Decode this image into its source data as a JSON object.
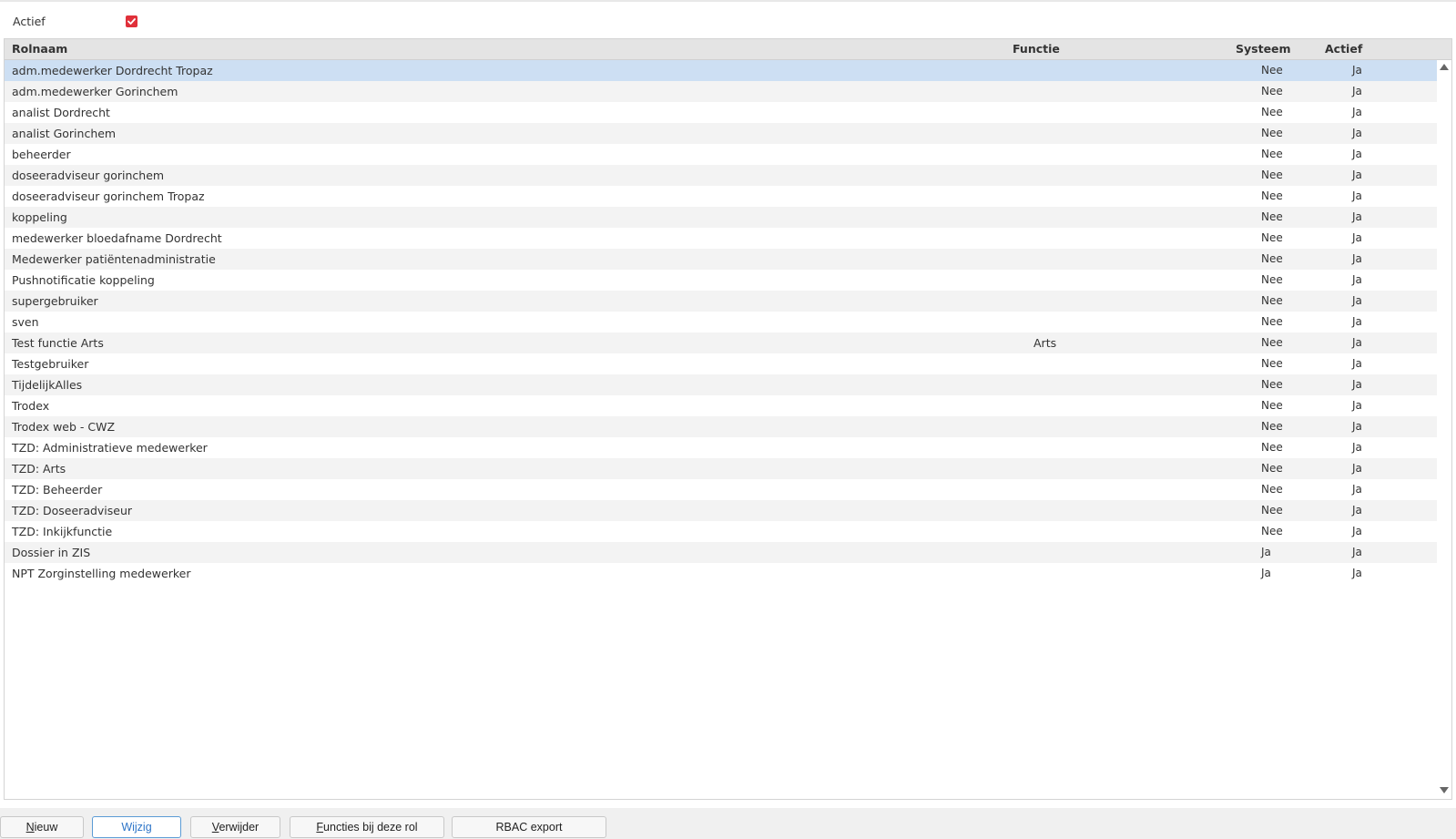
{
  "filter": {
    "label": "Actief",
    "checked": true,
    "check_color": "#e0303a"
  },
  "table": {
    "columns": {
      "name": "Rolnaam",
      "functie": "Functie",
      "systeem": "Systeem",
      "actief": "Actief"
    },
    "selected_index": 0,
    "rows": [
      {
        "name": "adm.medewerker Dordrecht Tropaz",
        "functie": "",
        "systeem": "Nee",
        "actief": "Ja"
      },
      {
        "name": "adm.medewerker Gorinchem",
        "functie": "",
        "systeem": "Nee",
        "actief": "Ja"
      },
      {
        "name": "analist Dordrecht",
        "functie": "",
        "systeem": "Nee",
        "actief": "Ja"
      },
      {
        "name": "analist Gorinchem",
        "functie": "",
        "systeem": "Nee",
        "actief": "Ja"
      },
      {
        "name": "beheerder",
        "functie": "",
        "systeem": "Nee",
        "actief": "Ja"
      },
      {
        "name": "doseeradviseur gorinchem",
        "functie": "",
        "systeem": "Nee",
        "actief": "Ja"
      },
      {
        "name": "doseeradviseur gorinchem Tropaz",
        "functie": "",
        "systeem": "Nee",
        "actief": "Ja"
      },
      {
        "name": "koppeling",
        "functie": "",
        "systeem": "Nee",
        "actief": "Ja"
      },
      {
        "name": "medewerker bloedafname Dordrecht",
        "functie": "",
        "systeem": "Nee",
        "actief": "Ja"
      },
      {
        "name": "Medewerker patiëntenadministratie",
        "functie": "",
        "systeem": "Nee",
        "actief": "Ja"
      },
      {
        "name": "Pushnotificatie koppeling",
        "functie": "",
        "systeem": "Nee",
        "actief": "Ja"
      },
      {
        "name": "supergebruiker",
        "functie": "",
        "systeem": "Nee",
        "actief": "Ja"
      },
      {
        "name": "sven",
        "functie": "",
        "systeem": "Nee",
        "actief": "Ja"
      },
      {
        "name": "Test functie Arts",
        "functie": "Arts",
        "systeem": "Nee",
        "actief": "Ja"
      },
      {
        "name": "Testgebruiker",
        "functie": "",
        "systeem": "Nee",
        "actief": "Ja"
      },
      {
        "name": "TijdelijkAlles",
        "functie": "",
        "systeem": "Nee",
        "actief": "Ja"
      },
      {
        "name": "Trodex",
        "functie": "",
        "systeem": "Nee",
        "actief": "Ja"
      },
      {
        "name": "Trodex web - CWZ",
        "functie": "",
        "systeem": "Nee",
        "actief": "Ja"
      },
      {
        "name": "TZD: Administratieve medewerker",
        "functie": "",
        "systeem": "Nee",
        "actief": "Ja"
      },
      {
        "name": "TZD: Arts",
        "functie": "",
        "systeem": "Nee",
        "actief": "Ja"
      },
      {
        "name": "TZD: Beheerder",
        "functie": "",
        "systeem": "Nee",
        "actief": "Ja"
      },
      {
        "name": "TZD: Doseeradviseur",
        "functie": "",
        "systeem": "Nee",
        "actief": "Ja"
      },
      {
        "name": "TZD: Inkijkfunctie",
        "functie": "",
        "systeem": "Nee",
        "actief": "Ja"
      },
      {
        "name": "Dossier in ZIS",
        "functie": "",
        "systeem": "Ja",
        "actief": "Ja"
      },
      {
        "name": "NPT Zorginstelling medewerker",
        "functie": "",
        "systeem": "Ja",
        "actief": "Ja"
      }
    ]
  },
  "buttons": {
    "nieuw": {
      "mnemonic": "N",
      "rest": "ieuw"
    },
    "wijzig": {
      "label": "Wijzig"
    },
    "verwijder": {
      "mnemonic": "V",
      "rest": "erwijder"
    },
    "functies": {
      "mnemonic": "F",
      "rest": "uncties bij deze rol"
    },
    "rbac": {
      "label": "RBAC export"
    }
  },
  "colors": {
    "selected_row": "#cddff3",
    "alt_row": "#f3f3f3",
    "header_bg": "#e4e4e4",
    "active_button_border": "#5b9bd5"
  }
}
